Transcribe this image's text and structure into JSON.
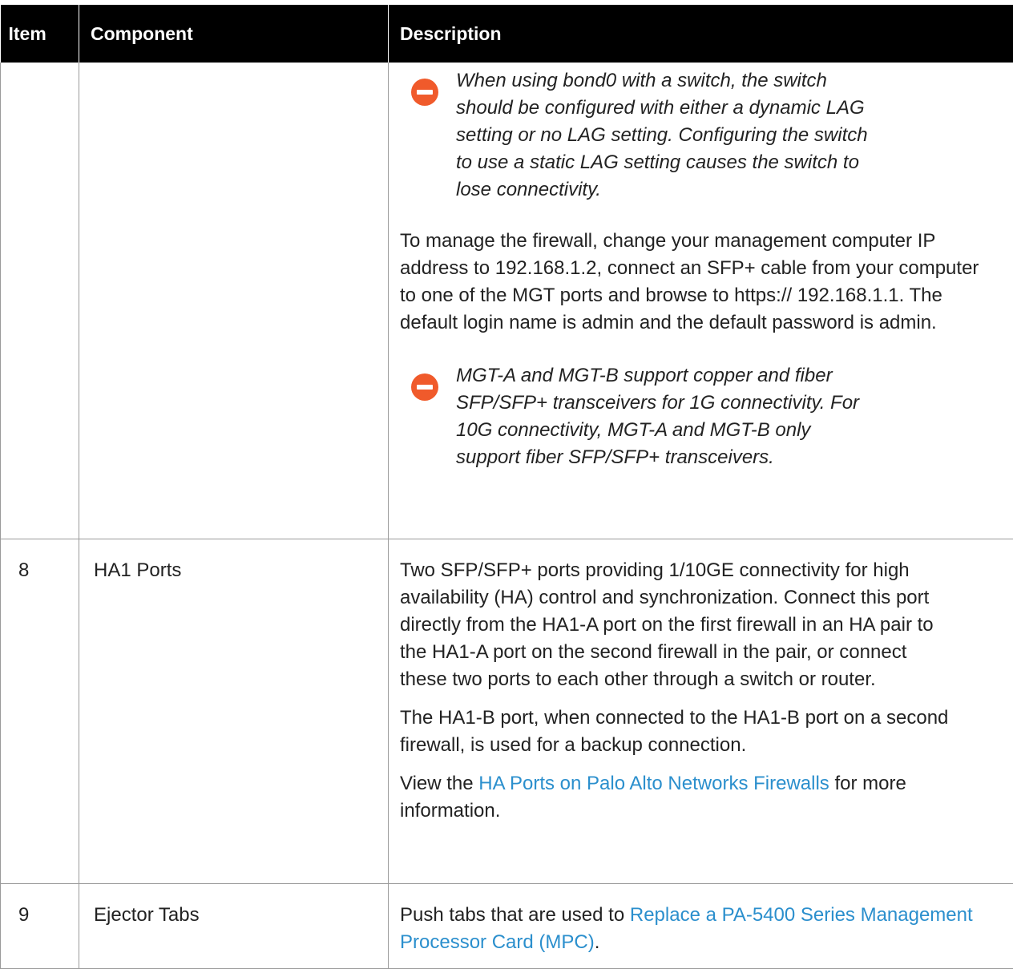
{
  "table": {
    "headers": [
      "Item",
      "Component",
      "Description"
    ],
    "continued_row": {
      "note1": "When using bond0 with a switch, the switch should be configured with either a dynamic LAG setting or no LAG setting. Configuring the switch to use a static LAG setting causes the switch to lose connectivity.",
      "para": "To manage the firewall, change your management computer IP address to 192.168.1.2, connect an SFP+ cable from your computer to one of the MGT ports and browse to https:// 192.168.1.1. The default login name is admin and the default password is admin.",
      "note2": "MGT-A and MGT-B support copper and fiber SFP/SFP+ transceivers for 1G connectivity. For 10G connectivity, MGT-A and MGT-B only support fiber SFP/SFP+ transceivers."
    },
    "rows": [
      {
        "item": "8",
        "component": "HA1 Ports",
        "para1": "Two SFP/SFP+ ports providing 1/10GE connectivity for high availability (HA) control and synchronization. Connect this port directly from the HA1-A port on the first firewall in an HA pair to the HA1-A port on the second firewall in the pair, or connect these two ports to each other through a switch or router.",
        "para2": "The HA1-B port, when connected to the HA1-B port on a second firewall, is used for a backup connection.",
        "para3_pre": "View the ",
        "para3_link": "HA Ports on Palo Alto Networks Firewalls",
        "para3_post": " for more information."
      },
      {
        "item": "9",
        "component": "Ejector Tabs",
        "para_pre": "Push tabs that are used to ",
        "para_link": "Replace a PA-5400 Series Management Processor Card (MPC)",
        "para_post": "."
      }
    ]
  },
  "colors": {
    "header_bg": "#000000",
    "link": "#2b8fcd",
    "caution_icon": "#f05a2b"
  },
  "icons": [
    "caution-icon"
  ]
}
